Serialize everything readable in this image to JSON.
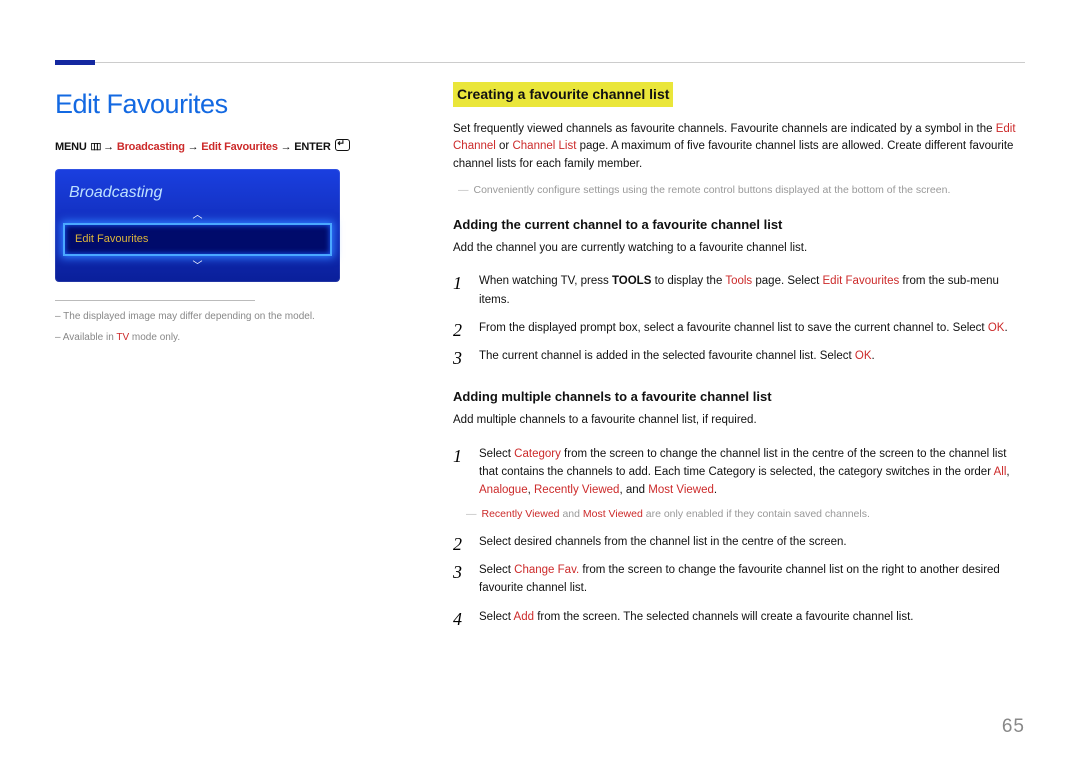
{
  "page_number": "65",
  "left": {
    "title": "Edit Favourites",
    "path": {
      "menu_label": "MENU",
      "menu_icon_name": "menu-grid-icon",
      "arrow": "→",
      "p1": "Broadcasting",
      "p2": "Edit Favourites",
      "enter_label": "ENTER",
      "enter_icon_name": "enter-icon"
    },
    "screen": {
      "panel_title": "Broadcasting",
      "selected_item": "Edit Favourites"
    },
    "notes": {
      "n1_pre": "The displayed image may differ depending on the model.",
      "n2_pre": "Available in ",
      "n2_accent": "TV",
      "n2_post": " mode only."
    }
  },
  "right": {
    "headline": "Creating a favourite channel list",
    "intro": {
      "t1": "Set frequently viewed channels as favourite channels. Favourite channels are indicated by a symbol in the ",
      "a1": "Edit Channel",
      "t2": " or ",
      "a2": "Channel List",
      "t3": " page. A maximum of five favourite channel lists are allowed. Create different favourite channel lists for each family member."
    },
    "intro_note": "Conveniently configure settings using the remote control buttons displayed at the bottom of the screen.",
    "sec1": {
      "head": "Adding the current channel to a favourite channel list",
      "lead": "Add the channel you are currently watching to a favourite channel list.",
      "s1": {
        "t1": "When watching TV, press ",
        "b1": "TOOLS",
        "t2": " to display the ",
        "a1": "Tools",
        "t3": " page. Select ",
        "a2": "Edit Favourites",
        "t4": " from the sub-menu items."
      },
      "s2": {
        "t1": "From the displayed prompt box, select a favourite channel list to save the current channel to. Select ",
        "a1": "OK",
        "t2": "."
      },
      "s3": {
        "t1": "The current channel is added in the selected favourite channel list. Select ",
        "a1": "OK",
        "t2": "."
      }
    },
    "sec2": {
      "head": "Adding multiple channels to a favourite channel list",
      "lead": "Add multiple channels to a favourite channel list, if required.",
      "s1": {
        "t1": "Select ",
        "a1": "Category",
        "t2": " from the screen to change the channel list in the centre of the screen to the channel list that contains the channels to add. Each time Category is selected, the category switches in the order ",
        "a2": "All",
        "c1": ", ",
        "a3": "Analogue",
        "c2": ", ",
        "a4": "Recently Viewed",
        "c3": ", and ",
        "a5": "Most Viewed",
        "t3": "."
      },
      "s1_note": {
        "a1": "Recently Viewed",
        "t1": " and ",
        "a2": "Most Viewed",
        "t2": " are only enabled if they contain saved channels."
      },
      "s2": "Select desired channels from the channel list in the centre of the screen.",
      "s3": {
        "t1": "Select ",
        "a1": "Change Fav.",
        "t2": " from the screen to change the favourite channel list on the right to another desired favourite channel list."
      },
      "s4": {
        "t1": "Select ",
        "a1": "Add",
        "t2": " from the screen. The selected channels will create a favourite channel list."
      }
    }
  }
}
